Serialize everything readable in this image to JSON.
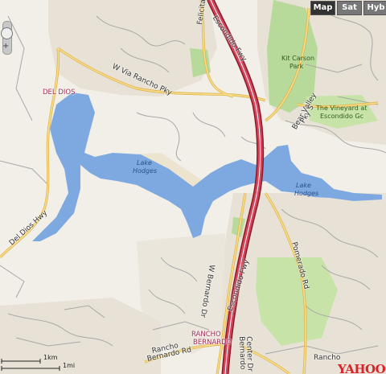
{
  "map_controls": {
    "map_label": "Map",
    "sat_label": "Sat",
    "hyb_label": "Hyb"
  },
  "labels": {
    "del_dios_place": "DEL DIOS",
    "rancho_bernardo_place_1": "RANCHO",
    "rancho_bernardo_place_2": "BERNARDO",
    "lake_hodges_west_1": "Lake",
    "lake_hodges_west_2": "Hodges",
    "lake_hodges_east_1": "Lake",
    "lake_hodges_east_2": "Hodges",
    "kit_carson_1": "Kit Carson",
    "kit_carson_2": "Park",
    "vineyard_1": "The Vineyard at",
    "vineyard_2": "Escondido Gc",
    "via_rancho": "W Via Rancho Pky",
    "felicita": "Felicita",
    "escondido_fwy_north": "Escondido Fwy",
    "escondido_fwy_south": "Escondido Fwy",
    "bear_valley_1": "Bear Valley",
    "bear_valley_2": "Pky S",
    "del_dios_hwy": "Del Dios Hwy",
    "pomerado": "Pomerado Rd",
    "w_bernardo": "W Bernardo Dr",
    "bernardo_center_1": "Bernardo",
    "bernardo_center_2": "Center Dr",
    "rancho_bernardo_rd_1": "Rancho",
    "rancho_bernardo_rd_2": "Bernardo Rd",
    "rancho_east": "Rancho"
  },
  "scale": {
    "km_label": "1km",
    "mi_label": "1mi"
  },
  "provider": {
    "logo_text": "YAHOO!"
  },
  "colors": {
    "land": "#f2efe9",
    "urban": "#e8e2d6",
    "water": "#7ea9e0",
    "park": "#b7d99a",
    "golf": "#c7e3a8",
    "freeway": "#b8273a",
    "major_road": "#f3cd6a",
    "local_road": "#a8a8a8"
  }
}
